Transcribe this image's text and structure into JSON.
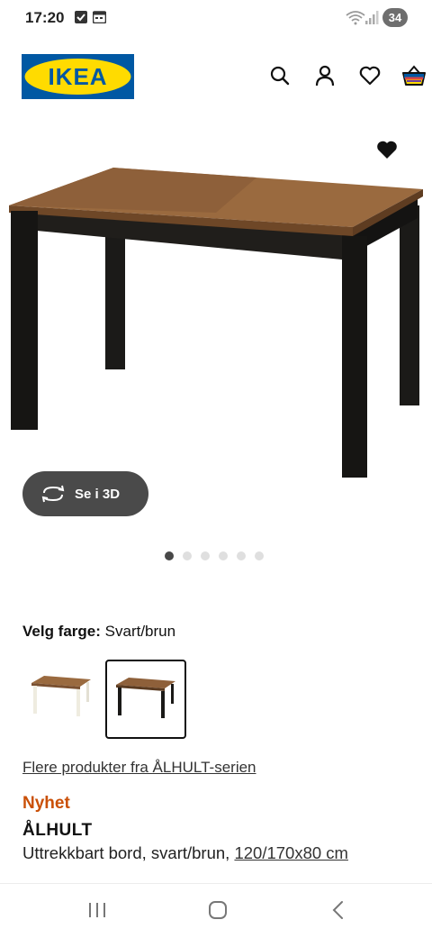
{
  "status_bar": {
    "time": "17:20",
    "battery": "34",
    "icons": [
      "check-square-icon",
      "calendar-icon",
      "wifi-icon",
      "signal-icon"
    ]
  },
  "header": {
    "logo_text": "IKEA",
    "brand_colors": {
      "blue": "#0058a3",
      "yellow": "#ffdb00"
    },
    "icons": [
      "search-icon",
      "user-icon",
      "heart-icon",
      "basket-icon"
    ]
  },
  "gallery": {
    "view_3d_label": "Se i 3D",
    "dot_count": 6,
    "active_dot": 1
  },
  "color_selection": {
    "label": "Velg farge:",
    "selected_value": "Svart/brun",
    "swatches": [
      {
        "name": "white-brown",
        "selected": false
      },
      {
        "name": "black-brown",
        "selected": true
      }
    ]
  },
  "product": {
    "series_link": "Flere produkter fra ÅLHULT-serien",
    "badge": "Nyhet",
    "badge_color": "#ca5008",
    "name": "ÅLHULT",
    "description": "Uttrekkbart bord, svart/brun, ",
    "dimensions": "120/170x80 cm"
  },
  "nav_bar": {
    "icons": [
      "recent-apps-icon",
      "home-icon",
      "back-icon"
    ]
  }
}
